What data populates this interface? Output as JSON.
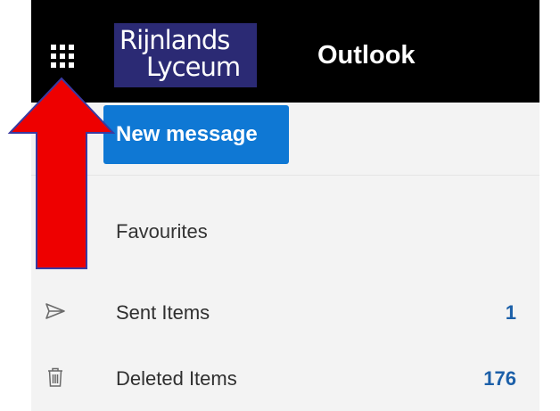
{
  "header": {
    "logo_line1": "Rijnlands",
    "logo_line2": "Lyceum",
    "logo_bg": "#2b2a74",
    "app_name": "Outlook",
    "app_launcher_icon": "waffle-grid-icon"
  },
  "toolbar": {
    "new_message_label": "New message",
    "accent": "#0f78d4"
  },
  "folders": {
    "favourites_label": "Favourites",
    "items": [
      {
        "label": "Sent Items",
        "count": "1",
        "icon": "send-icon"
      },
      {
        "label": "Deleted Items",
        "count": "176",
        "icon": "trash-icon"
      }
    ]
  },
  "annotation": {
    "arrow_color": "#ee0000",
    "arrow_direction": "up",
    "points_to": "app-launcher"
  }
}
